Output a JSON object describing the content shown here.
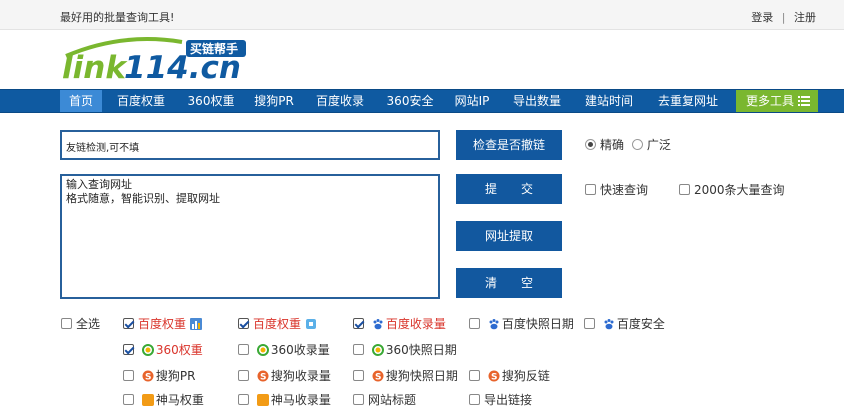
{
  "topbar": {
    "slogan": "最好用的批量查询工具!",
    "login": "登录",
    "separator": "|",
    "register": "注册"
  },
  "logo": {
    "text": "link114.cn",
    "badge": "买链帮手"
  },
  "nav": {
    "items": [
      {
        "label": "首页"
      },
      {
        "label": "百度权重"
      },
      {
        "label": "360权重"
      },
      {
        "label": "搜狗PR"
      },
      {
        "label": "百度收录"
      },
      {
        "label": "360安全"
      },
      {
        "label": "网站IP"
      },
      {
        "label": "导出数量"
      },
      {
        "label": "建站时间"
      },
      {
        "label": "去重复网址"
      }
    ],
    "more": "更多工具"
  },
  "form": {
    "link_input": "友链检测,可不填",
    "url_textarea": "输入查询网址\n格式随意，智能识别、提取网址",
    "btn_check": "检查是否撤链",
    "btn_submit": "提　　交",
    "btn_extract": "网址提取",
    "btn_clear": "清　　空",
    "radio_exact": "精确",
    "radio_broad": "广泛",
    "chk_fast": "快速查询",
    "chk_bulk": "2000条大量查询"
  },
  "options": {
    "select_all": "全选",
    "row1": [
      "百度权重",
      "百度权重",
      "百度收录量",
      "百度快照日期",
      "百度安全"
    ],
    "row2": [
      "360权重",
      "360收录量",
      "360快照日期"
    ],
    "row3": [
      "搜狗PR",
      "搜狗收录量",
      "搜狗快照日期",
      "搜狗反链"
    ],
    "row4": [
      "神马权重",
      "神马收录量",
      "网站标题",
      "导出链接"
    ]
  }
}
